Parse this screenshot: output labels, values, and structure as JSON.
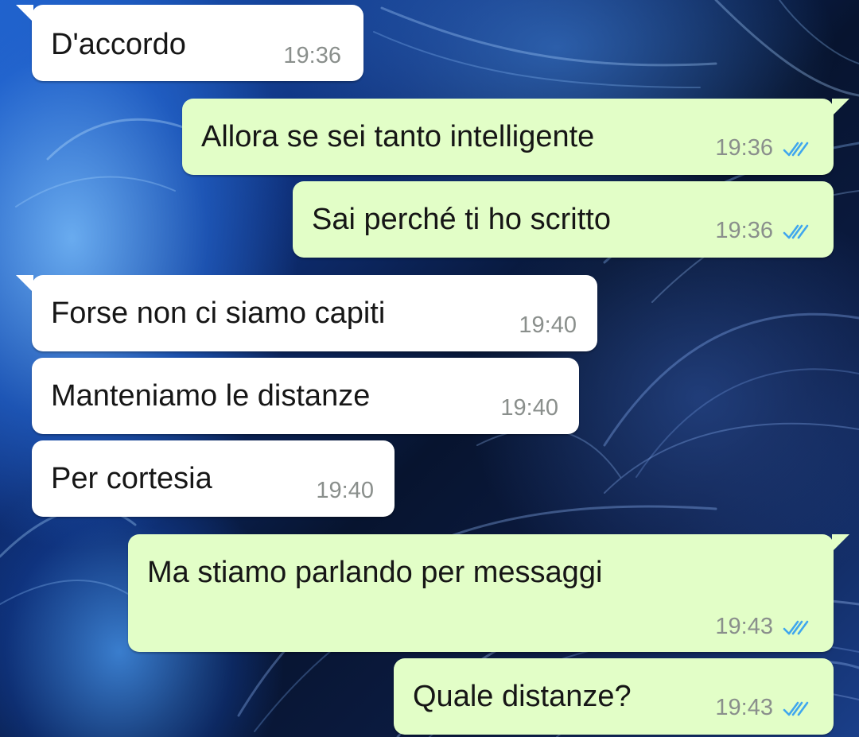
{
  "colors": {
    "incoming_bubble": "#ffffff",
    "outgoing_bubble": "#e2fec7",
    "read_ticks": "#3fa6ee",
    "timestamp": "#8a8f8c"
  },
  "messages": [
    {
      "direction": "incoming",
      "text": "D'accordo",
      "time": "19:36"
    },
    {
      "direction": "outgoing",
      "text": "Allora se sei tanto intelligente",
      "time": "19:36",
      "status": "read-double-check-icon"
    },
    {
      "direction": "outgoing",
      "text": "Sai perché ti ho scritto",
      "time": "19:36",
      "status": "read-double-check-icon"
    },
    {
      "direction": "incoming",
      "text": "Forse non ci siamo capiti",
      "time": "19:40"
    },
    {
      "direction": "incoming",
      "text": "Manteniamo le distanze",
      "time": "19:40"
    },
    {
      "direction": "incoming",
      "text": "Per cortesia",
      "time": "19:40"
    },
    {
      "direction": "outgoing",
      "text": "Ma stiamo parlando per messaggi",
      "time": "19:43",
      "status": "read-double-check-icon"
    },
    {
      "direction": "outgoing",
      "text": "Quale distanze?",
      "time": "19:43",
      "status": "read-double-check-icon"
    }
  ]
}
